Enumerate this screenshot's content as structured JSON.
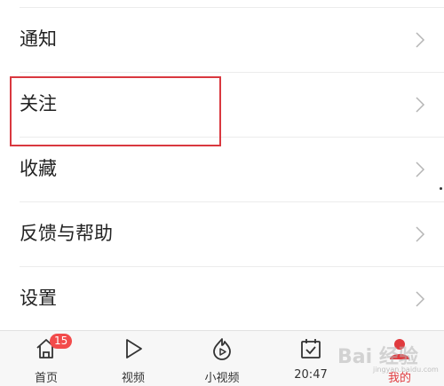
{
  "menu": {
    "items": [
      {
        "label": "通知"
      },
      {
        "label": "关注"
      },
      {
        "label": "收藏"
      },
      {
        "label": "反馈与帮助"
      },
      {
        "label": "设置"
      }
    ]
  },
  "tabbar": {
    "tabs": [
      {
        "label": "首页",
        "icon": "home-icon",
        "badge": "15"
      },
      {
        "label": "视频",
        "icon": "play-icon"
      },
      {
        "label": "小视频",
        "icon": "flame-play-icon"
      },
      {
        "label": "20:47",
        "icon": "calendar-check-icon"
      },
      {
        "label": "我的",
        "icon": "person-icon",
        "active": true
      }
    ]
  },
  "watermark": {
    "main": "Bai 经验",
    "sub": "jingyan.baidu.com"
  },
  "colors": {
    "highlight": "#d9383f",
    "accent": "#e03a3e",
    "badge": "#f24b4b"
  }
}
